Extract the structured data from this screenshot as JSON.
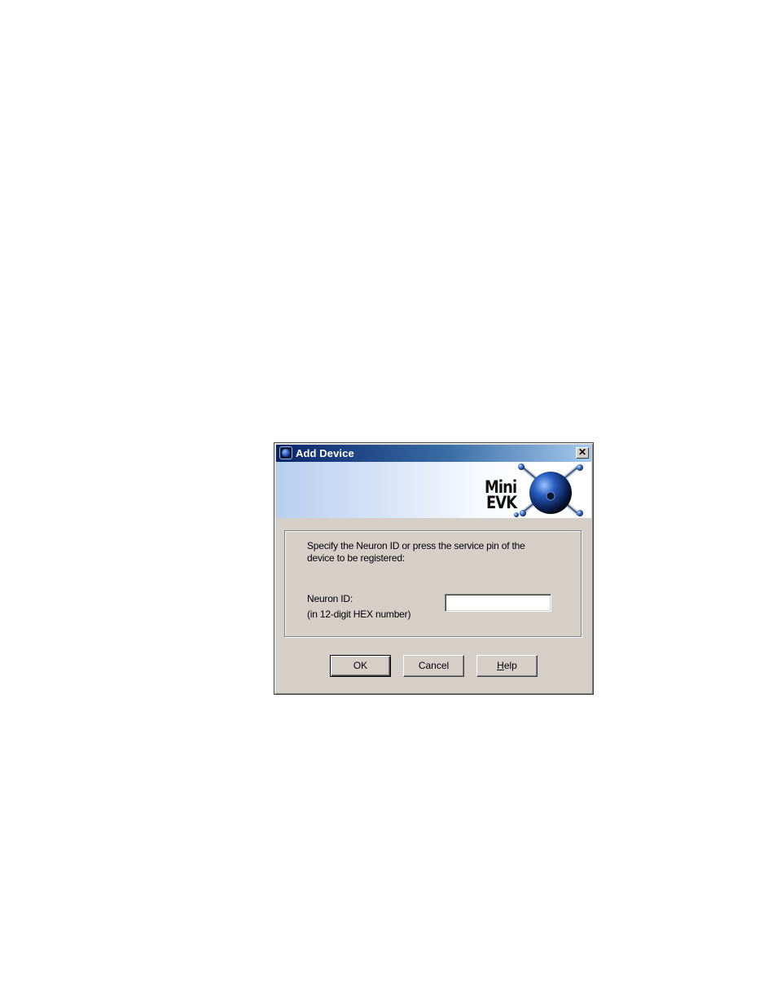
{
  "window": {
    "title": "Add Device",
    "close_glyph": "✕"
  },
  "banner": {
    "logo_line1": "Mini",
    "logo_line2": "EVK"
  },
  "form": {
    "instruction_line1": "Specify the Neuron ID or press the service pin of the",
    "instruction_line2": "device to be registered:",
    "neuron_label": "Neuron ID:",
    "neuron_hint": "(in 12-digit HEX number)",
    "neuron_value": ""
  },
  "buttons": {
    "ok": "OK",
    "cancel": "Cancel",
    "help_accel": "H",
    "help_rest": "elp"
  },
  "colors": {
    "title_bar_start": "#0a246a",
    "title_bar_end": "#a6caf0",
    "dialog_face": "#d4d0c8"
  },
  "icons": [
    "app-icon",
    "close-icon",
    "mini-evk-logo"
  ]
}
